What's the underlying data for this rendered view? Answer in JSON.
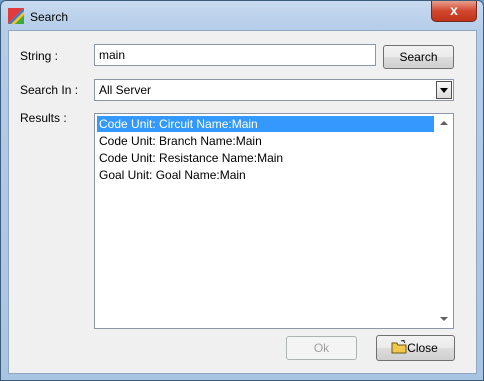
{
  "window": {
    "title": "Search",
    "close_glyph": "x"
  },
  "form": {
    "string_label": "String :",
    "string_value": "main",
    "search_button": "Search",
    "search_in_label": "Search  In :",
    "search_in_value": "All Server",
    "results_label": "Results :"
  },
  "results": [
    {
      "text": "Code Unit: Circuit Name:Main",
      "selected": true
    },
    {
      "text": "Code Unit: Branch Name:Main",
      "selected": false
    },
    {
      "text": "Code Unit: Resistance Name:Main",
      "selected": false
    },
    {
      "text": "Goal Unit: Goal Name:Main",
      "selected": false
    }
  ],
  "buttons": {
    "ok": "Ok",
    "close": "Close"
  },
  "icons": {
    "app": "app-icon",
    "close_btn": "folder-icon"
  },
  "colors": {
    "selection": "#3399ff",
    "close_red": "#d2462e"
  }
}
